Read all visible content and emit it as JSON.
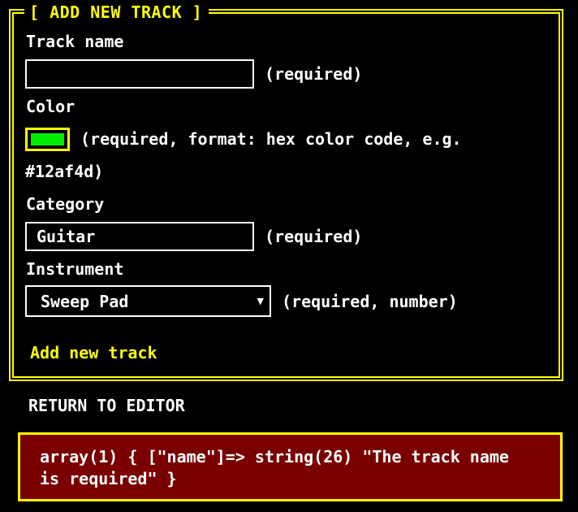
{
  "form": {
    "legend": "[ ADD NEW TRACK ]",
    "track_name": {
      "label": "Track name",
      "value": "",
      "hint": "(required)"
    },
    "color": {
      "label": "Color",
      "swatch": "#00ee00",
      "hint_line1": "(required, format: hex color code, e.g.",
      "hint_line2": "#12af4d)"
    },
    "category": {
      "label": "Category",
      "value": "Guitar",
      "hint": "(required)"
    },
    "instrument": {
      "label": "Instrument",
      "selected": "Sweep Pad",
      "hint": "(required, number)"
    },
    "submit_label": "Add new track"
  },
  "return_link": "RETURN TO EDITOR",
  "error": {
    "message": "array(1) { [\"name\"]=> string(26) \"The track name\nis required\" }"
  },
  "colors": {
    "accent": "#ffff00",
    "text": "#ffffff",
    "background": "#000000",
    "error_bg": "#7a0000"
  }
}
